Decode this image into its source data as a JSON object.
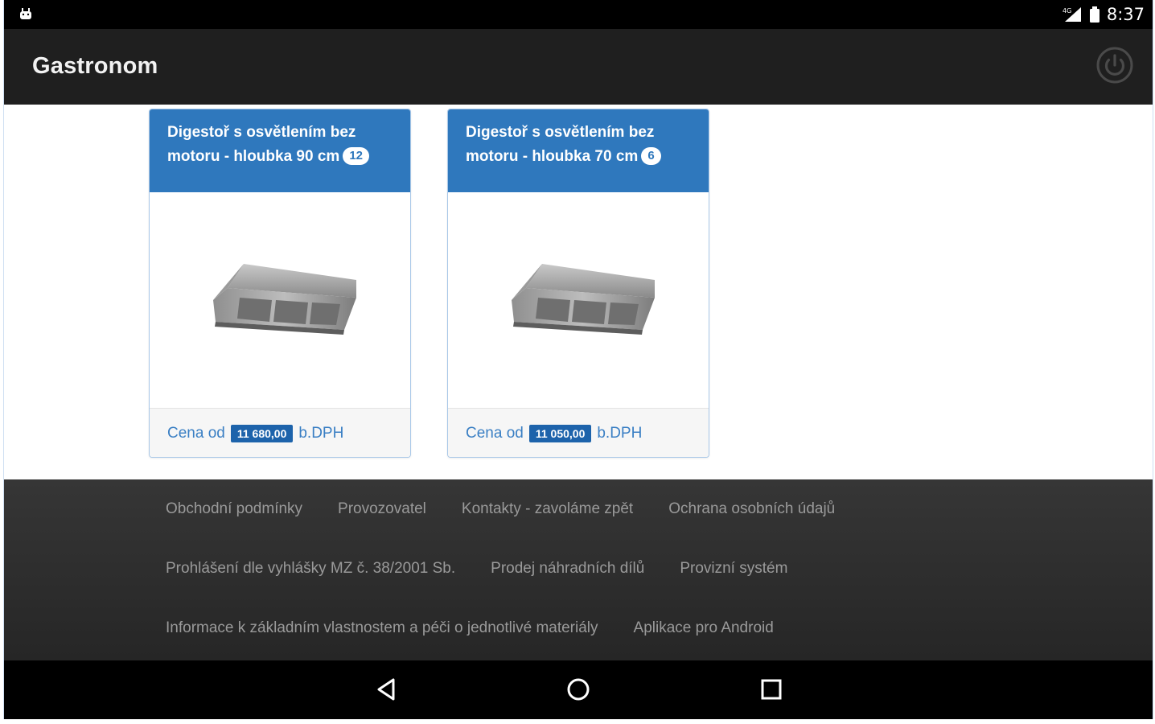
{
  "status_bar": {
    "time": "8:37",
    "icons": [
      "android-icon",
      "signal-icon",
      "battery-icon"
    ]
  },
  "app_bar": {
    "title": "Gastronom",
    "power_icon": "power-icon"
  },
  "products": [
    {
      "title": "Digestoř s osvětlením bez motoru - hloubka 90 cm",
      "count": "12",
      "price_prefix": "Cena od",
      "price": "11 680,00",
      "price_suffix": "b.DPH",
      "image": "kitchen-hood-image"
    },
    {
      "title": "Digestoř s osvětlením bez motoru - hloubka 70 cm",
      "count": "6",
      "price_prefix": "Cena od",
      "price": "11 050,00",
      "price_suffix": "b.DPH",
      "image": "kitchen-hood-image"
    }
  ],
  "footer": {
    "links_row1": [
      "Obchodní podmínky",
      "Provozovatel",
      "Kontakty - zavoláme zpět",
      "Ochrana osobních údajů"
    ],
    "links_row2": [
      "Prohlášení dle vyhlášky MZ č. 38/2001 Sb.",
      "Prodej náhradních dílů",
      "Provizní systém"
    ],
    "links_row3": [
      "Informace k základním vlastnostem a péči o jednotlivé materiály",
      "Aplikace pro Android"
    ]
  },
  "nav_bar": {
    "icons": [
      "back-icon",
      "home-icon",
      "recents-icon"
    ]
  },
  "colors": {
    "accent": "#2f78bd",
    "price_bg": "#1d63ab",
    "app_bar": "#1f1f1f",
    "footer": "#303030"
  }
}
